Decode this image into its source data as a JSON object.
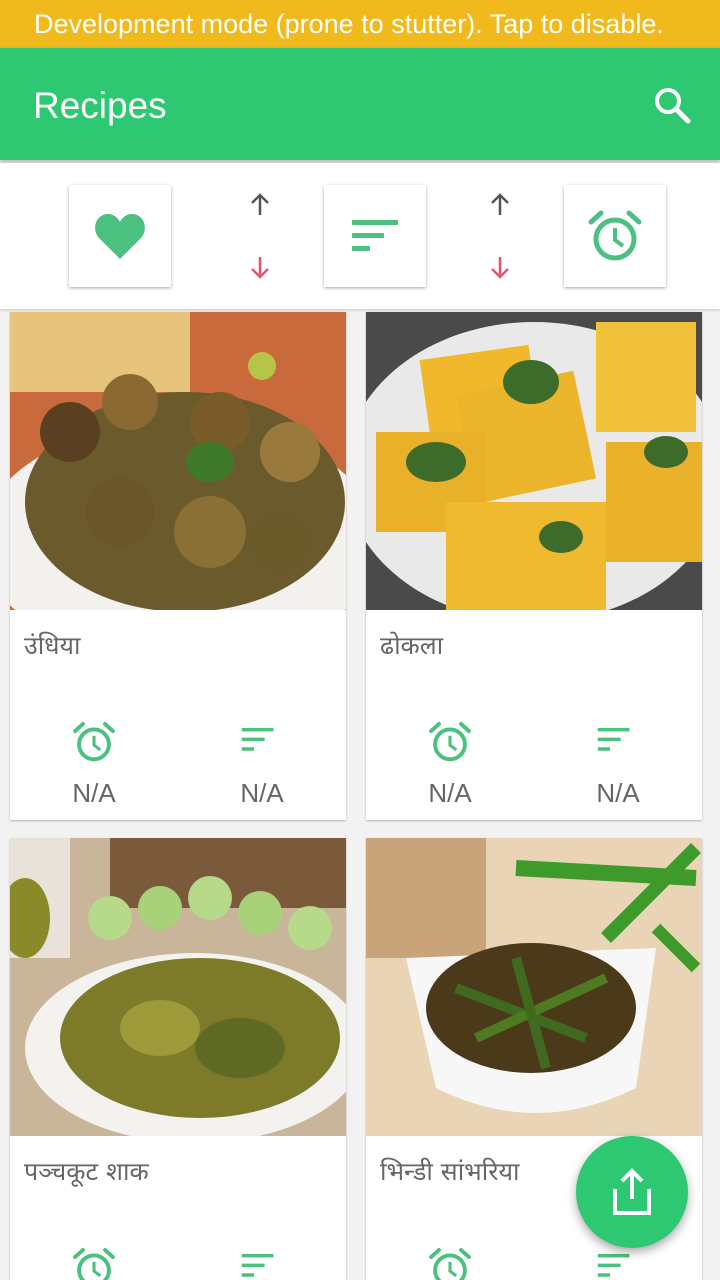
{
  "dev_banner": {
    "text": "Development mode (prone to stutter). Tap to disable."
  },
  "app_bar": {
    "title": "Recipes",
    "search_icon": "search-icon"
  },
  "filter_bar": {
    "buttons": [
      {
        "icon": "heart-icon"
      },
      {
        "icon": "sort-icon"
      },
      {
        "icon": "alarm-clock-icon"
      }
    ],
    "sort_arrows": [
      "arrow-up-icon",
      "arrow-down-icon"
    ]
  },
  "recipes": [
    {
      "name": "उंधिया",
      "time": "N/A",
      "difficulty": "N/A",
      "image": "undhiyu-photo"
    },
    {
      "name": "ढोकला",
      "time": "N/A",
      "difficulty": "N/A",
      "image": "dhokla-photo"
    },
    {
      "name": "पञ्चकूट शाक",
      "time": "",
      "difficulty": "",
      "image": "panchkut-shaak-photo"
    },
    {
      "name": "भिन्डी सांभरिया",
      "time": "",
      "difficulty": "",
      "image": "bhindi-sambhariya-photo"
    }
  ],
  "fab": {
    "icon": "share-icon"
  },
  "colors": {
    "primary": "#2ec872",
    "banner": "#f0b91c",
    "arrow_down": "#e0566e",
    "arrow_up": "#555555"
  }
}
